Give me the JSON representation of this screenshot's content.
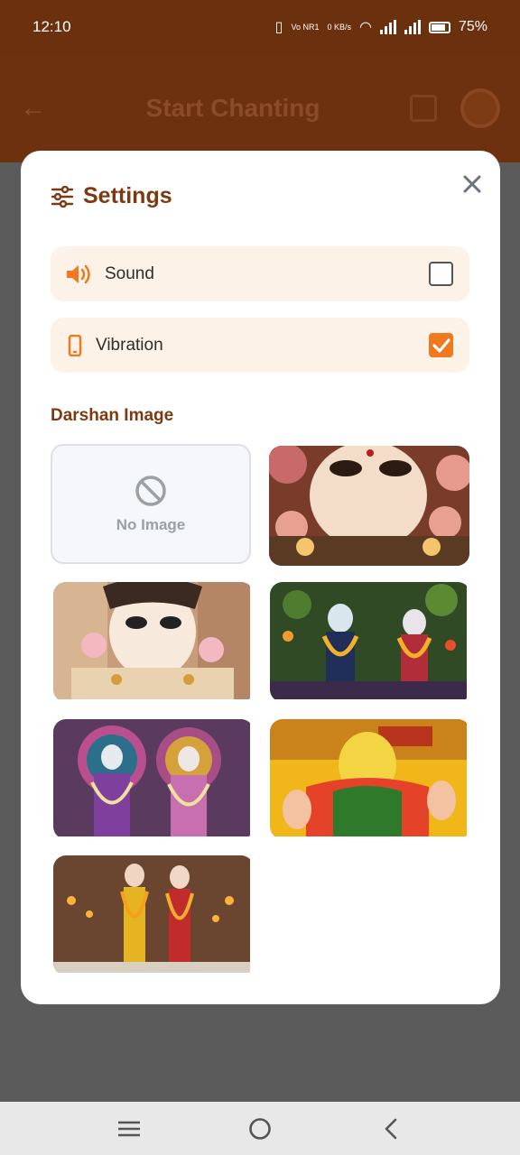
{
  "status": {
    "time": "12:10",
    "battery": "75%",
    "volte": "Vo NR1",
    "netspeed": "0 KB/s"
  },
  "app": {
    "title": "Start Chanting"
  },
  "settings": {
    "title": "Settings",
    "sound": {
      "label": "Sound",
      "checked": false
    },
    "vibration": {
      "label": "Vibration",
      "checked": true
    },
    "darshan_title": "Darshan Image",
    "no_image_label": "No Image",
    "images": [
      "radha-face",
      "radha-portrait",
      "radha-krishna-garden",
      "radha-krishna-peacock",
      "saint-yellow",
      "ram-sita"
    ]
  },
  "colors": {
    "accent": "#f0781f",
    "title": "#7c3a12",
    "rowbg": "#fdf2e7"
  }
}
